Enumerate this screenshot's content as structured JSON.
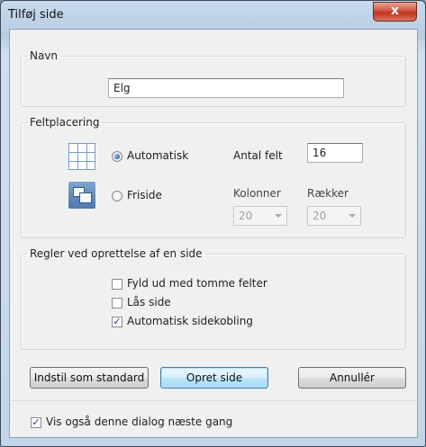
{
  "window": {
    "title": "Tilføj side",
    "close_glyph": "x"
  },
  "name_group": {
    "legend": "Navn",
    "value": "Elg"
  },
  "placement_group": {
    "legend": "Feltplacering",
    "auto_label": "Automatisk",
    "free_label": "Friside",
    "selected": "Automatisk",
    "field_count_label": "Antal felt",
    "field_count_value": "16",
    "columns_label": "Kolonner",
    "rows_label": "Rækker",
    "columns_value": "20",
    "rows_value": "20",
    "icons": {
      "auto": "grid-icon",
      "free": "free-page-icon"
    }
  },
  "rules_group": {
    "legend": "Regler ved oprettelse af en side",
    "items": [
      {
        "label": "Fyld ud med tomme felter",
        "checked": false
      },
      {
        "label": "Lås side",
        "checked": false
      },
      {
        "label": "Automatisk sidekobling",
        "checked": true
      }
    ]
  },
  "buttons": {
    "set_default": "Indstil som standard",
    "create": "Opret side",
    "cancel": "Annullér"
  },
  "footer": {
    "show_again_label": "Vis også denne dialog næste gang",
    "show_again_checked": true
  },
  "glyphs": {
    "check": "✓"
  }
}
